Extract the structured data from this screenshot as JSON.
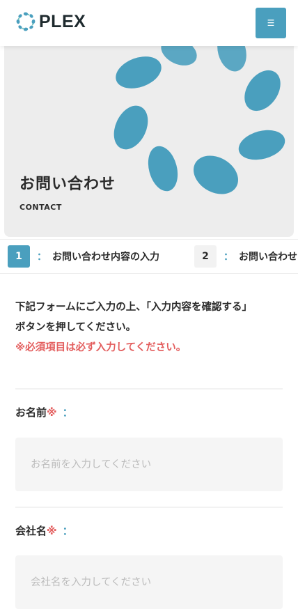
{
  "header": {
    "logo_text": "PLEX",
    "menu_icon": "☰"
  },
  "hero": {
    "title": "お問い合わせ",
    "subtitle": "CONTACT"
  },
  "steps": [
    {
      "number": "1",
      "separator": "：",
      "label": "お問い合わせ内容の入力"
    },
    {
      "number": "2",
      "separator": "：",
      "label": "お問い合わせ内容の確認"
    }
  ],
  "intro": {
    "line1": "下記フォームにご入力の上、「入力内容を確認する」",
    "line2": "ボタンを押してください。",
    "required_note": "※必須項目は必ず入力してください。"
  },
  "fields": [
    {
      "label": "お名前",
      "required_mark": "※",
      "colon": "：",
      "placeholder": "お名前を入力してください",
      "value": ""
    },
    {
      "label": "会社名",
      "required_mark": "※",
      "colon": "：",
      "placeholder": "会社名を入力してください",
      "value": ""
    }
  ],
  "colors": {
    "accent": "#4a9fbe",
    "required": "#e35d5d"
  }
}
